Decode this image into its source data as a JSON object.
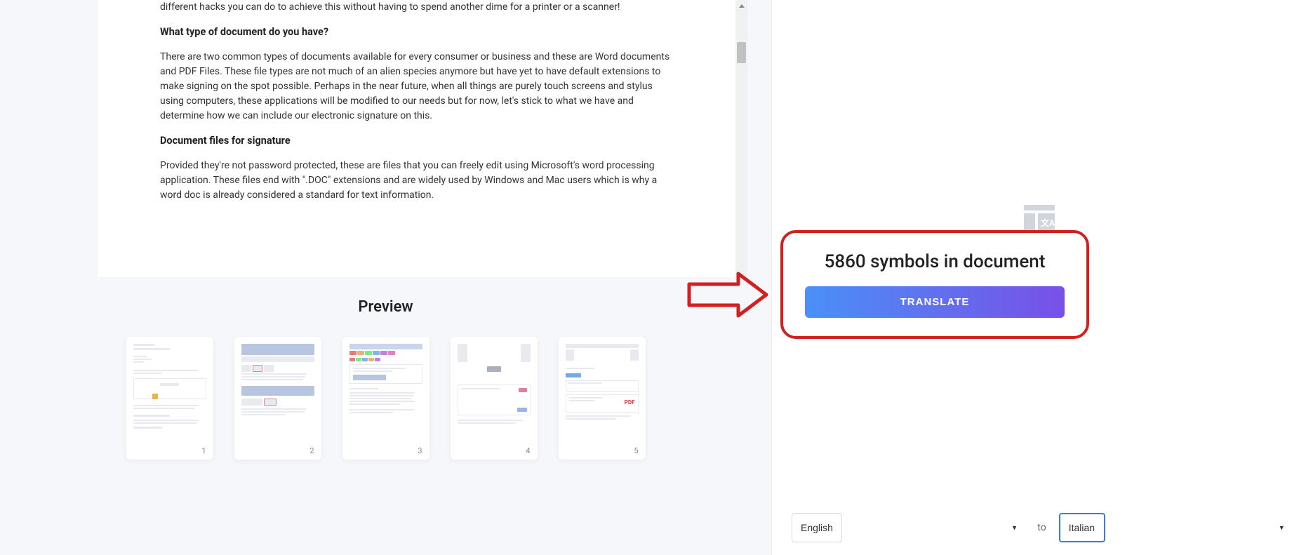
{
  "document": {
    "p1": "different hacks you can do to achieve this without having to spend another dime for a printer or a scanner!",
    "h1": "What type of document do you have?",
    "p2": "There are two common types of documents available for every consumer or business and these are Word documents and PDF Files. These file types are not much of an alien species anymore but have yet to have default extensions to make signing on the spot possible. Perhaps in the near future, when all things are purely touch screens and stylus using computers, these applications will be modified to our needs but for now, let's stick to what we have and determine how we can include our electronic signature on this.",
    "h2": "Document files for signature",
    "p3": "Provided they're not password protected, these are files that you can freely edit using Microsoft's word processing application. These files end with \".DOC\" extensions and are widely used by Windows and Mac users which is why a word doc is already considered a standard for text information."
  },
  "preview": {
    "title": "Preview",
    "pages": [
      "1",
      "2",
      "3",
      "4",
      "5"
    ]
  },
  "translate": {
    "symbols_text": "5860 symbols in document",
    "button_label": "TRANSLATE"
  },
  "lang": {
    "source": "English",
    "to_label": "to",
    "target": "Italian"
  }
}
